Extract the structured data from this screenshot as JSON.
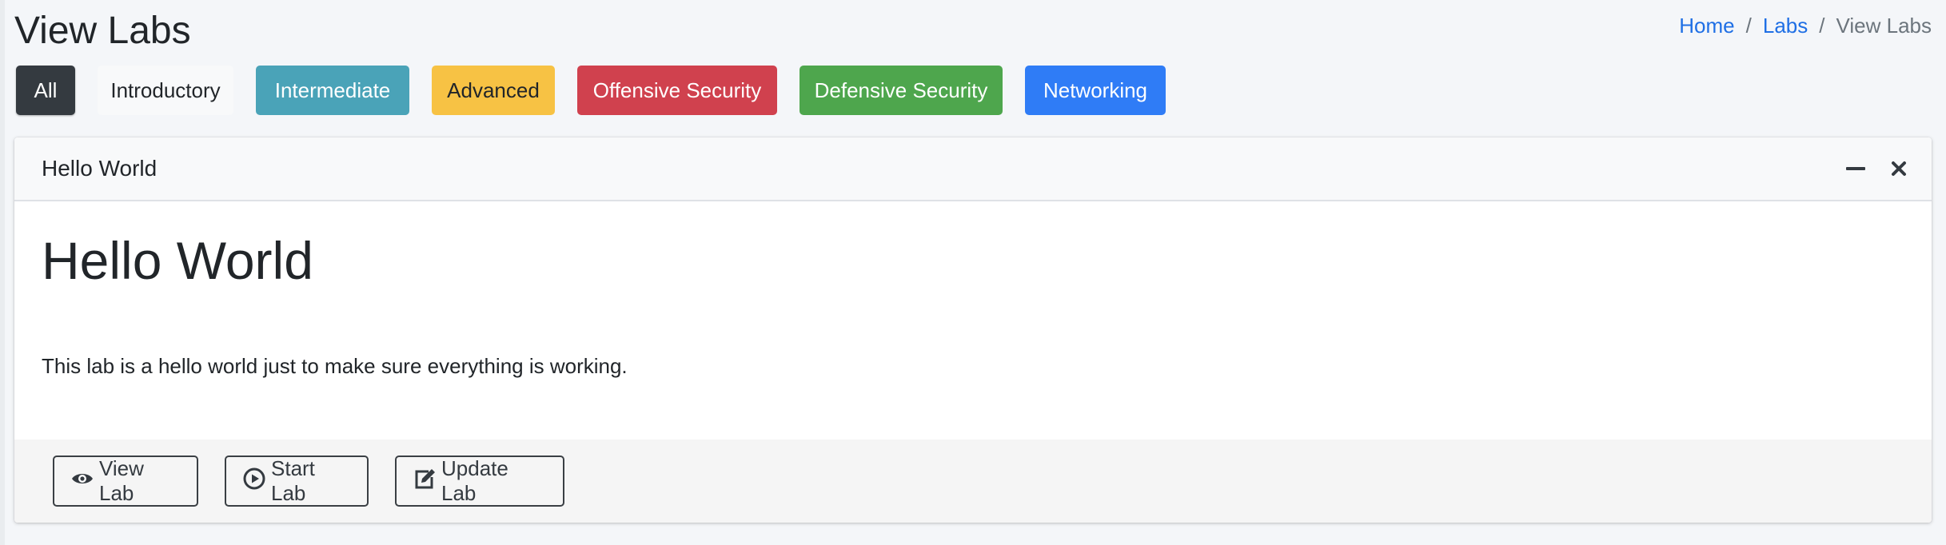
{
  "header": {
    "title": "View Labs"
  },
  "breadcrumb": {
    "home": "Home",
    "labs": "Labs",
    "current": "View Labs",
    "separator": "/"
  },
  "filters": {
    "all": "All",
    "introductory": "Introductory",
    "intermediate": "Intermediate",
    "advanced": "Advanced",
    "offensive": "Offensive Security",
    "defensive": "Defensive Security",
    "networking": "Networking"
  },
  "colors": {
    "all": "#343a40",
    "introductory": "#f8f9fa",
    "intermediate": "#4aa3b8",
    "advanced": "#f7c244",
    "offensive": "#d0414e",
    "defensive": "#4ea64d",
    "networking": "#2f7cf6",
    "link": "#1f6fe5"
  },
  "card": {
    "header_title": "Hello World",
    "heading": "Hello World",
    "description": "This lab is a hello world just to make sure everything is working.",
    "tools": {
      "collapse_icon": "minus-icon",
      "remove_icon": "close-icon"
    }
  },
  "actions": {
    "view": {
      "label": "View Lab",
      "icon": "eye-icon"
    },
    "start": {
      "label": "Start Lab",
      "icon": "play-circle-icon"
    },
    "update": {
      "label": "Update Lab",
      "icon": "edit-icon"
    }
  }
}
